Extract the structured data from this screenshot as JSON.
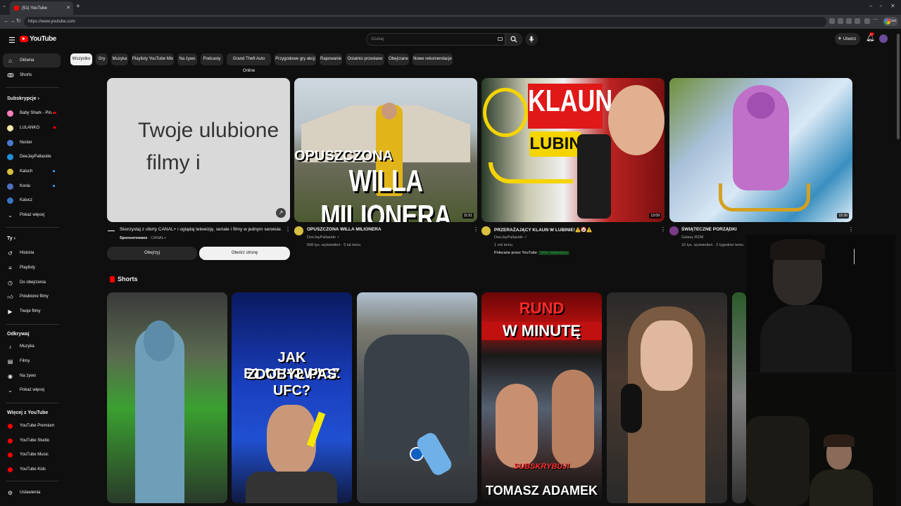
{
  "browser": {
    "tab_title": "(51) YouTube",
    "url": "https://www.youtube.com",
    "profile_label": "Czet"
  },
  "masthead": {
    "logo_text": "YouTube",
    "search_placeholder": "Szukaj",
    "create_label": "Utwórz",
    "notifications_badge": "9+"
  },
  "sidebar": {
    "main": [
      {
        "label": "Główna",
        "icon": "home-icon"
      },
      {
        "label": "Shorts",
        "icon": "shorts-icon"
      }
    ],
    "subscriptions_header": "Subskrypcje",
    "subscriptions": [
      {
        "label": "Baby Shark - Pin...",
        "color": "#ff80c0",
        "live": "red"
      },
      {
        "label": "LULANKO",
        "color": "#f5e6a8",
        "live": "red"
      },
      {
        "label": "Nester",
        "color": "#4a7bd0",
        "live": "none"
      },
      {
        "label": "DeeJayPallaside",
        "color": "#1f8fd6",
        "live": "none"
      },
      {
        "label": "Kaluch",
        "color": "#d8c040",
        "live": "dot"
      },
      {
        "label": "Koniu",
        "color": "#4f6fbf",
        "live": "dot"
      },
      {
        "label": "Kalucz",
        "color": "#3a74c4",
        "live": "none"
      }
    ],
    "show_more_1": "Pokaż więcej",
    "you_header": "Ty",
    "you": [
      {
        "label": "Historia",
        "icon": "history-icon"
      },
      {
        "label": "Playlisty",
        "icon": "playlists-icon"
      },
      {
        "label": "Do obejrzenia",
        "icon": "watch-later-icon"
      },
      {
        "label": "Polubione filmy",
        "icon": "liked-icon"
      },
      {
        "label": "Twoje filmy",
        "icon": "your-videos-icon"
      }
    ],
    "explore_header": "Odkrywaj",
    "explore": [
      {
        "label": "Muzyka",
        "icon": "music-icon"
      },
      {
        "label": "Filmy",
        "icon": "films-icon"
      },
      {
        "label": "Na żywo",
        "icon": "live-icon"
      }
    ],
    "show_more_2": "Pokaż więcej",
    "more_header": "Więcej z YouTube",
    "more": [
      {
        "label": "YouTube Premium"
      },
      {
        "label": "YouTube Studio"
      },
      {
        "label": "YouTube Music"
      },
      {
        "label": "YouTube Kids"
      }
    ],
    "settings": "Ustawienia"
  },
  "chips": [
    "Wszystko",
    "Gry",
    "Muzyka",
    "Playlisty YouTube Mix",
    "Na żywo",
    "Podcasty",
    "Grand Theft Auto Online",
    "Przygodowe gry akcji",
    "Rapowanie",
    "Ostatnio przesłane",
    "Obejrzane",
    "Nowe rekomendacje"
  ],
  "ad": {
    "thumb_line1": "Twoje ulubione",
    "thumb_line2": "filmy i",
    "title": "Skorzystaj z oferty CANAL+ i oglądaj telewizję, seriale i filmy w jednym serwisie.",
    "sponsored": "Sponsorowane",
    "advertiser": "CANAL+",
    "button_watch": "Obejrzyj",
    "button_open": "Otwórz stronę"
  },
  "videos": [
    {
      "title": "OPUSZCZONA WILLA MILIONERA",
      "channel": "DeeJayPallaside",
      "meta": "508 tys. wyświetleń · 5 lat temu",
      "duration": "11:51",
      "thumb_top": "OPUSZCZONA",
      "thumb_big": "WILLA MILIONERA"
    },
    {
      "title": "PRZERAŻAJĄCY KLAUN W LUBINIE!⚠️🤡⚠️",
      "channel": "DeeJayPallaside",
      "meta": "1 rok temu",
      "promo": "Polecane przez YouTube",
      "promo_badge": "Tylko ewpenjący",
      "duration": "13:09",
      "thumb_top": "KLAUN",
      "thumb_big": "LUBIN"
    },
    {
      "title": "ŚWIĄTECZNE PORZĄDKI",
      "channel": "Galaxy RDM",
      "meta": "16 tys. wyświetleń · 2 tygodnie temu",
      "duration": "15:36"
    }
  ],
  "shorts_header": "Shorts",
  "shorts": [
    {
      "text": ""
    },
    {
      "text_line1": "JAK BŁACHOWICZ",
      "text_line2": "ZDOBYŁ PAS UFC?"
    },
    {
      "text": ""
    },
    {
      "text_top1": "RUND",
      "text_top2": "W MINUTĘ",
      "text_bottom1": "SUBSKRYBUJ!",
      "text_bottom2": "TOMASZ ADAMEK"
    },
    {
      "text": ""
    }
  ],
  "colors": {
    "bg": "#0f0f0f",
    "chip": "#272727",
    "accent_red": "#ff0000",
    "text": "#f1f1f1",
    "muted": "#aaaaaa"
  }
}
